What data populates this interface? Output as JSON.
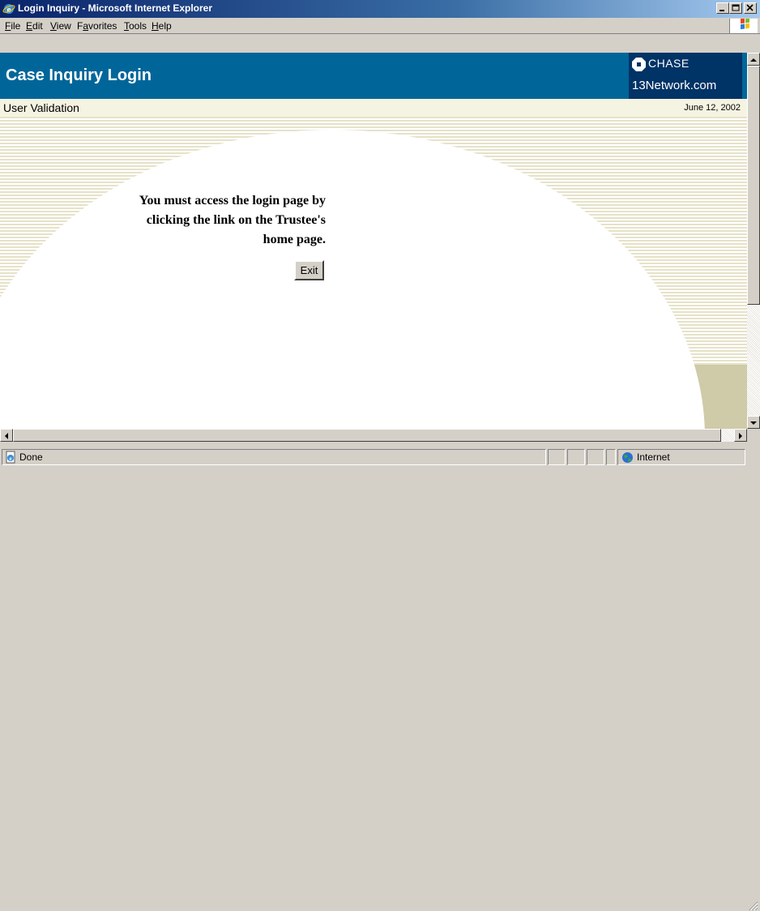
{
  "window": {
    "title": "Login Inquiry - Microsoft Internet Explorer"
  },
  "menu": {
    "items": [
      {
        "label": "File"
      },
      {
        "label": "Edit"
      },
      {
        "label": "View"
      },
      {
        "label": "Favorites"
      },
      {
        "label": "Tools"
      },
      {
        "label": "Help"
      }
    ]
  },
  "page": {
    "header_title": "Case Inquiry Login",
    "brand_name": "CHASE",
    "brand_site": "13Network.com",
    "subheader_label": "User Validation",
    "date": "June 12, 2002",
    "message_lines": [
      "You must access the login page by",
      "clicking the link on the Trustee's",
      "home page."
    ],
    "exit_label": "Exit"
  },
  "status": {
    "text": "Done",
    "zone": "Internet"
  },
  "colors": {
    "titlebar": "#0a246a",
    "banner": "#006699",
    "brand_box": "#003366",
    "subheader": "#f5f3e1",
    "background_tan": "#cfcaa8"
  },
  "icons": {
    "title": "ie-icon",
    "brand": "chase-octagon-icon",
    "status": "page-done-icon",
    "zone": "internet-globe-icon"
  }
}
